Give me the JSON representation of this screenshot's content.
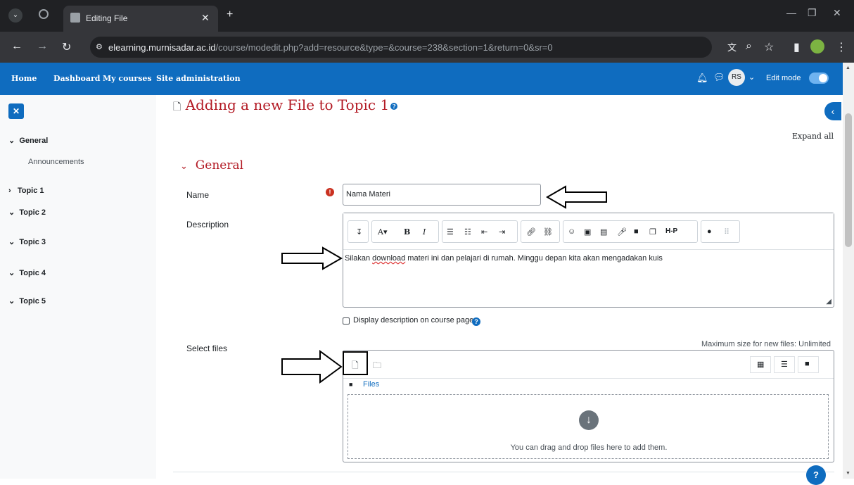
{
  "browser": {
    "tab_title": "Editing File",
    "url_domain": "elearning.murnisadar.ac.id",
    "url_path": "/course/modedit.php?add=resource&type=&course=238&section=1&return=0&sr=0"
  },
  "navbar": {
    "links": [
      "Home",
      "Dashboard",
      "My courses",
      "Site administration"
    ],
    "avatar_initials": "RS",
    "edit_mode_label": "Edit mode",
    "edit_mode_on": true
  },
  "drawer": {
    "items": [
      {
        "label": "General",
        "expanded": true
      },
      {
        "label": "Announcements",
        "sub": true
      },
      {
        "label": "Topic 1",
        "expanded": false
      },
      {
        "label": "Topic 2",
        "expanded": true
      },
      {
        "label": "Topic 3",
        "expanded": true
      },
      {
        "label": "Topic 4",
        "expanded": true
      },
      {
        "label": "Topic 5",
        "expanded": true
      }
    ]
  },
  "main": {
    "page_title": "Adding a new File to Topic 1",
    "expand_all": "Expand all",
    "section_title": "General",
    "name_label": "Name",
    "name_value": "Nama Materi",
    "description_label": "Description",
    "description_value": "Silakan download materi ini dan pelajari di rumah. Minggu depan kita akan mengadakan kuis",
    "description_misspelled_word": "download",
    "display_description_label": "Display description on course page",
    "select_files_label": "Select files",
    "max_size_text": "Maximum size for new files: Unlimited",
    "files_breadcrumb": "Files",
    "drop_text": "You can drag and drop files here to add them."
  },
  "colors": {
    "brand": "#0f6cbf",
    "title_red": "#b31a24",
    "required": "#ca3120"
  }
}
